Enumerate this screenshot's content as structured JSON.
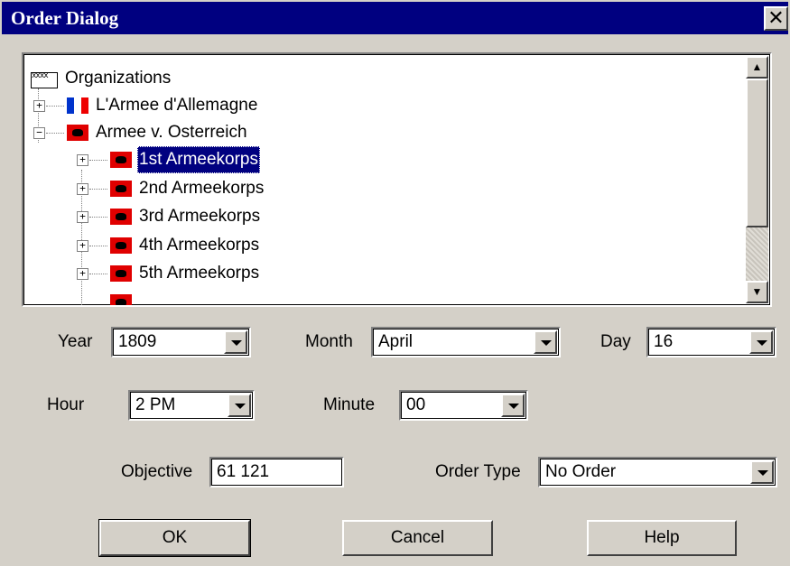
{
  "window": {
    "title": "Order Dialog",
    "close_glyph": "✕"
  },
  "tree": {
    "root_label": "Organizations",
    "nodes": [
      {
        "label": "L'Armee d'Allemagne",
        "icon": "flag-france-icon",
        "expander": "+"
      },
      {
        "label": "Armee v. Osterreich",
        "icon": "flag-austria-icon",
        "expander": "−"
      },
      {
        "label": "1st Armeekorps",
        "icon": "flag-austria-icon",
        "expander": "+",
        "selected": true
      },
      {
        "label": "2nd Armeekorps",
        "icon": "flag-austria-icon",
        "expander": "+"
      },
      {
        "label": "3rd Armeekorps",
        "icon": "flag-austria-icon",
        "expander": "+"
      },
      {
        "label": "4th Armeekorps",
        "icon": "flag-austria-icon",
        "expander": "+"
      },
      {
        "label": "5th Armeekorps",
        "icon": "flag-austria-icon",
        "expander": "+"
      }
    ],
    "scroll_up": "▲",
    "scroll_down": "▼"
  },
  "fields": {
    "year": {
      "label": "Year",
      "value": "1809"
    },
    "month": {
      "label": "Month",
      "value": "April"
    },
    "day": {
      "label": "Day",
      "value": "16"
    },
    "hour": {
      "label": "Hour",
      "value": "2 PM"
    },
    "minute": {
      "label": "Minute",
      "value": "00"
    },
    "objective": {
      "label": "Objective",
      "value": "61 121"
    },
    "order_type": {
      "label": "Order Type",
      "value": "No Order"
    }
  },
  "buttons": {
    "ok": "OK",
    "cancel": "Cancel",
    "help": "Help"
  },
  "colors": {
    "title_bar": "#000080",
    "face": "#d4d0c8",
    "selection": "#000080"
  }
}
